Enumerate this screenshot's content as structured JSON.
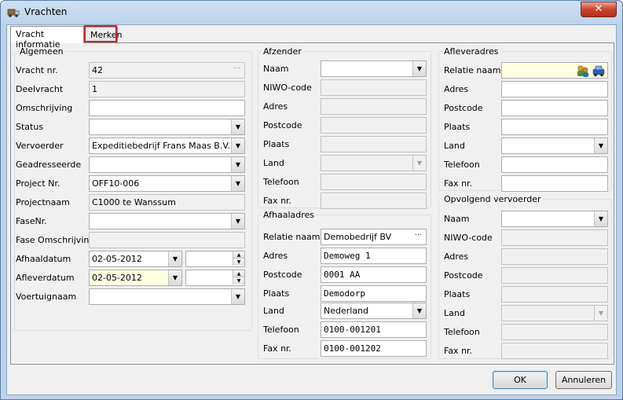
{
  "window": {
    "title": "Vrachten",
    "close": "✕"
  },
  "tabs": [
    {
      "label": "Vracht informatie"
    },
    {
      "label": "Merken"
    }
  ],
  "algemeen": {
    "legend": "Algemeen",
    "vracht_nr_label": "Vracht nr.",
    "vracht_nr": "42",
    "deelvracht_label": "Deelvracht",
    "deelvracht": "1",
    "omschrijving_label": "Omschrijving",
    "omschrijving": "",
    "status_label": "Status",
    "status": "",
    "vervoerder_label": "Vervoerder",
    "vervoerder": "Expeditiebedrijf Frans Maas B.V.",
    "geadresseerde_label": "Geadresseerde",
    "geadresseerde": "",
    "project_nr_label": "Project Nr.",
    "project_nr": "OFF10-006",
    "projectnaam_label": "Projectnaam",
    "projectnaam": "C1000 te Wanssum",
    "fasenr_label": "FaseNr.",
    "fasenr": "",
    "fase_omschrijving_label": "Fase Omschrijving",
    "fase_omschrijving": "",
    "afhaaldatum_label": "Afhaaldatum",
    "afhaaldatum": "02-05-2012",
    "afhaaltijd": "",
    "afleverdatum_label": "Afleverdatum",
    "afleverdatum": "02-05-2012",
    "aflevertijd": "",
    "voertuignaam_label": "Voertuignaam",
    "voertuignaam": ""
  },
  "afzender": {
    "legend": "Afzender",
    "naam_label": "Naam",
    "naam": "",
    "niwo_label": "NIWO-code",
    "niwo": "",
    "adres_label": "Adres",
    "adres": "",
    "postcode_label": "Postcode",
    "postcode": "",
    "plaats_label": "Plaats",
    "plaats": "",
    "land_label": "Land",
    "land": "",
    "telefoon_label": "Telefoon",
    "telefoon": "",
    "fax_label": "Fax nr.",
    "fax": ""
  },
  "afhaaladres": {
    "legend": "Afhaaladres",
    "relatie_label": "Relatie naam",
    "relatie": "Demobedrijf BV",
    "adres_label": "Adres",
    "adres": "Demoweg 1",
    "postcode_label": "Postcode",
    "postcode": "0001 AA",
    "plaats_label": "Plaats",
    "plaats": "Demodorp",
    "land_label": "Land",
    "land": "Nederland",
    "telefoon_label": "Telefoon",
    "telefoon": "0100-001201",
    "fax_label": "Fax nr.",
    "fax": "0100-001202"
  },
  "afleveradres": {
    "legend": "Afleveradres",
    "relatie_label": "Relatie naam",
    "relatie": "",
    "adres_label": "Adres",
    "adres": "",
    "postcode_label": "Postcode",
    "postcode": "",
    "plaats_label": "Plaats",
    "plaats": "",
    "land_label": "Land",
    "land": "",
    "telefoon_label": "Telefoon",
    "telefoon": "",
    "fax_label": "Fax nr.",
    "fax": ""
  },
  "opvolgend": {
    "legend": "Opvolgend vervoerder",
    "naam_label": "Naam",
    "naam": "",
    "niwo_label": "NIWO-code",
    "niwo": "",
    "adres_label": "Adres",
    "adres": "",
    "postcode_label": "Postcode",
    "postcode": "",
    "plaats_label": "Plaats",
    "plaats": "",
    "land_label": "Land",
    "land": "",
    "telefoon_label": "Telefoon",
    "telefoon": "",
    "fax_label": "Fax nr.",
    "fax": ""
  },
  "buttons": {
    "ok": "OK",
    "cancel": "Annuleren",
    "dots": "···"
  },
  "icons": {
    "window": "truck-icon",
    "relatie": "person-group-icon",
    "car": "car-icon"
  },
  "colors": {
    "highlight": "#c0282c",
    "yellow_field": "#ffffe1"
  }
}
